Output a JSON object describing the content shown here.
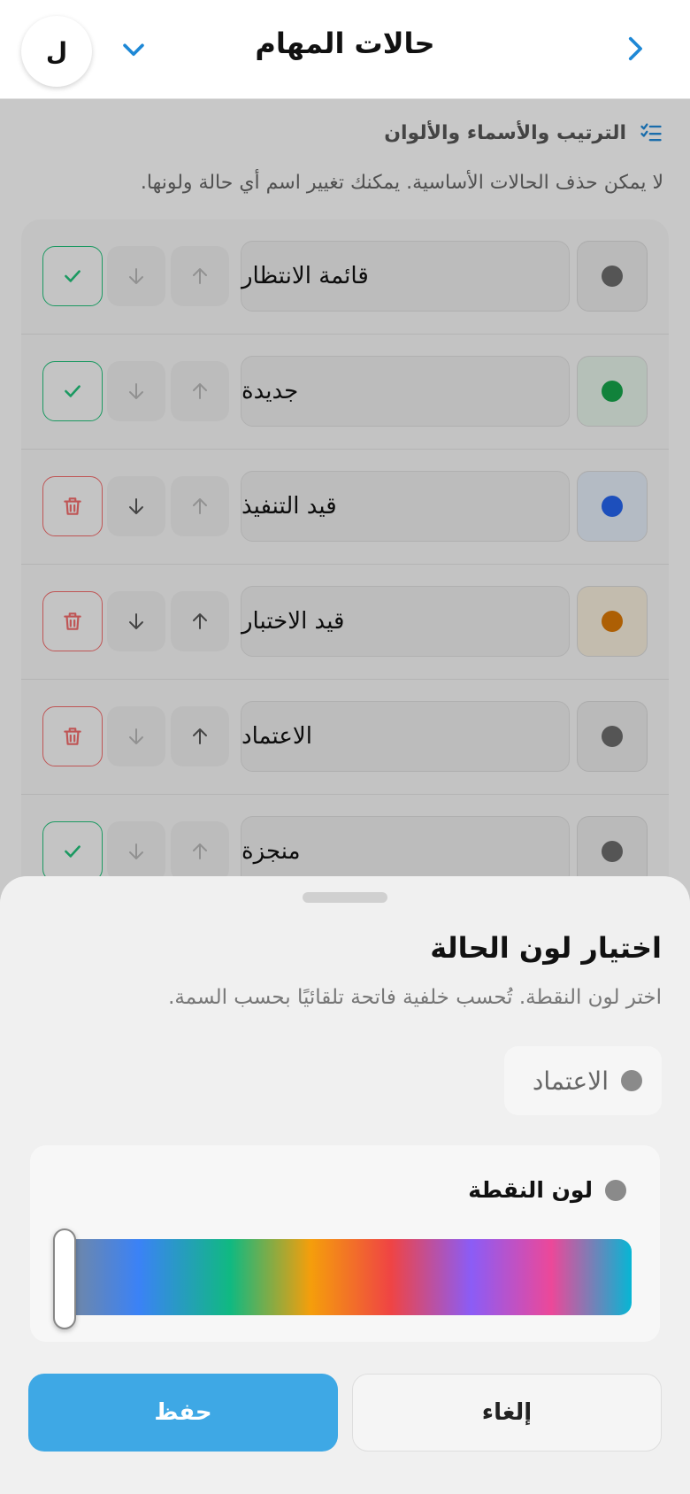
{
  "header": {
    "avatar_letter": "ل",
    "title": "حالات المهام"
  },
  "section": {
    "title": "الترتيب والأسماء والألوان",
    "description": "لا يمكن حذف الحالات الأساسية. يمكنك تغيير اسم أي حالة ولونها."
  },
  "statuses": [
    {
      "name": "قائمة الانتظار",
      "color": "#6b6b6b",
      "action": "check"
    },
    {
      "name": "جديدة",
      "color": "#16a34a",
      "action": "check"
    },
    {
      "name": "قيد التنفيذ",
      "color": "#2563eb",
      "action": "trash"
    },
    {
      "name": "قيد الاختبار",
      "color": "#d97706",
      "action": "trash"
    },
    {
      "name": "الاعتماد",
      "color": "#6b6b6b",
      "action": "trash"
    },
    {
      "name": "منجزة",
      "color": "#6b6b6b",
      "action": "check"
    }
  ],
  "sheet": {
    "title": "اختيار لون الحالة",
    "description": "اختر لون النقطة. تُحسب خلفية فاتحة تلقائيًا بحسب السمة.",
    "preview_name": "الاعتماد",
    "dot_label": "لون النقطة",
    "current_color": "#8a8a8a",
    "cancel_label": "إلغاء",
    "save_label": "حفظ"
  },
  "colors": {
    "accent": "#3ea8e5",
    "check": "#22c07a",
    "delete": "#ef6b6b"
  }
}
